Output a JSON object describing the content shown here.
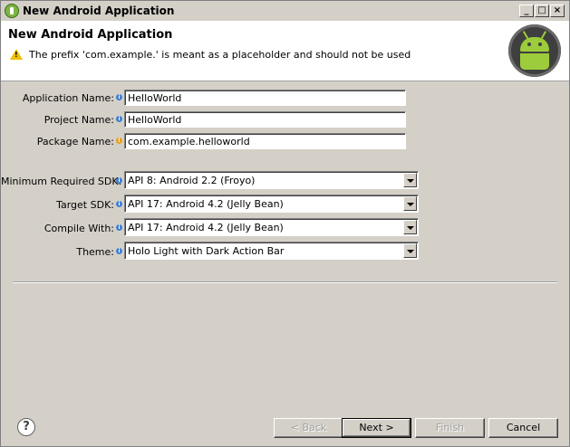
{
  "window": {
    "title": "New Android Application"
  },
  "header": {
    "title": "New Android Application",
    "message": "The prefix 'com.example.' is meant as a placeholder and should not be used",
    "icon": "android-logo"
  },
  "fields": {
    "application_name": {
      "label": "Application Name:",
      "value": "HelloWorld"
    },
    "project_name": {
      "label": "Project Name:",
      "value": "HelloWorld"
    },
    "package_name": {
      "label": "Package Name:",
      "value": "com.example.helloworld"
    }
  },
  "selects": {
    "min_sdk": {
      "label": "Minimum Required SDK:",
      "value": "API 8: Android 2.2 (Froyo)"
    },
    "target_sdk": {
      "label": "Target SDK:",
      "value": "API 17: Android 4.2 (Jelly Bean)"
    },
    "compile_with": {
      "label": "Compile With:",
      "value": "API 17: Android 4.2 (Jelly Bean)"
    },
    "theme": {
      "label": "Theme:",
      "value": "Holo Light with Dark Action Bar"
    }
  },
  "buttons": {
    "help": "?",
    "back": "< Back",
    "next": "Next >",
    "finish": "Finish",
    "cancel": "Cancel"
  },
  "colors": {
    "dialog_bg": "#d4d0c8",
    "header_bg": "#ffffff",
    "info_icon": "#3f7fd4",
    "warning_icon": "#e8a020",
    "android_green": "#9ccc3b"
  }
}
